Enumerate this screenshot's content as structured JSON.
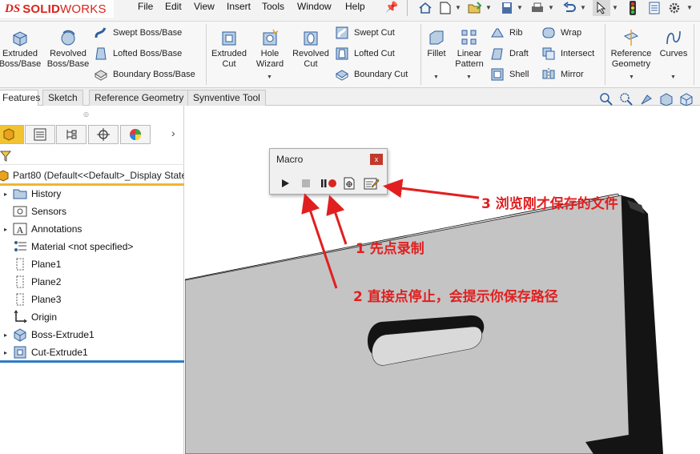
{
  "app": {
    "logo_prefix": "DS",
    "logo_brand_bold": "SOLID",
    "logo_brand_light": "WORKS",
    "menu": [
      "File",
      "Edit",
      "View",
      "Insert",
      "Tools",
      "Window",
      "Help"
    ]
  },
  "quick_access": [
    "home-icon",
    "new-document-icon",
    "open-icon",
    "save-icon",
    "print-icon",
    "undo-icon",
    "select-arrow-icon",
    "traffic-light-icon",
    "file-properties-icon",
    "options-gear-icon"
  ],
  "ribbon": {
    "extruded_boss": "Extruded\nBoss/Base",
    "revolved_boss": "Revolved\nBoss/Base",
    "swept_boss": "Swept Boss/Base",
    "lofted_boss": "Lofted Boss/Base",
    "boundary_boss": "Boundary Boss/Base",
    "extruded_cut": "Extruded\nCut",
    "hole_wizard": "Hole\nWizard",
    "revolved_cut": "Revolved\nCut",
    "swept_cut": "Swept Cut",
    "lofted_cut": "Lofted Cut",
    "boundary_cut": "Boundary Cut",
    "fillet": "Fillet",
    "linear_pattern": "Linear\nPattern",
    "rib": "Rib",
    "draft": "Draft",
    "shell": "Shell",
    "wrap": "Wrap",
    "intersect": "Intersect",
    "mirror": "Mirror",
    "reference_geometry": "Reference\nGeometry",
    "curves": "Curves"
  },
  "tabs": [
    "Features",
    "Sketch",
    "Reference Geometry",
    "Synventive Tool"
  ],
  "active_tab": "Features",
  "manager_tabs": [
    "feature-manager-icon",
    "property-manager-icon",
    "configuration-manager-icon",
    "dimxpert-icon",
    "display-manager-icon"
  ],
  "tree": {
    "part": "Part80  (Default<<Default>_Display State",
    "items": [
      {
        "label": "History",
        "icon": "history-folder-icon",
        "expandable": true
      },
      {
        "label": "Sensors",
        "icon": "sensors-icon",
        "expandable": false
      },
      {
        "label": "Annotations",
        "icon": "annotations-icon",
        "expandable": true
      },
      {
        "label": "Material <not specified>",
        "icon": "material-icon",
        "expandable": false
      },
      {
        "label": "Plane1",
        "icon": "plane-icon",
        "expandable": false
      },
      {
        "label": "Plane2",
        "icon": "plane-icon",
        "expandable": false
      },
      {
        "label": "Plane3",
        "icon": "plane-icon",
        "expandable": false
      },
      {
        "label": "Origin",
        "icon": "origin-icon",
        "expandable": false
      },
      {
        "label": "Boss-Extrude1",
        "icon": "boss-extrude-icon",
        "expandable": true
      },
      {
        "label": "Cut-Extrude1",
        "icon": "cut-extrude-icon",
        "expandable": true
      }
    ]
  },
  "macro": {
    "title": "Macro",
    "close": "x",
    "buttons": [
      "play-icon",
      "stop-icon",
      "pause-record-icon",
      "new-macro-icon",
      "edit-macro-icon"
    ]
  },
  "annotations": {
    "step1": "1 先点录制",
    "step2": "2 直接点停止，会提示你保存路径",
    "step3": "3 浏览刚才保存的文件"
  },
  "colors": {
    "accent_red": "#e11f1f",
    "brand_red": "#d9231b",
    "active_tab_yellow": "#f1c232",
    "tree_blue_line": "#2f7cc4",
    "model_gray": "#c4c4c4"
  }
}
